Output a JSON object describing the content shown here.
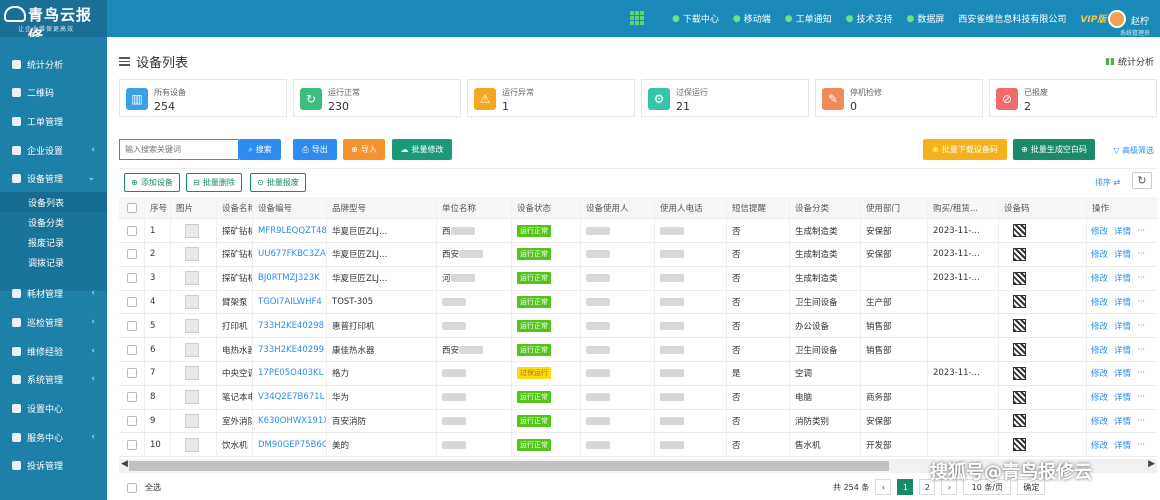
{
  "brand": {
    "title": "青鸟云报修",
    "slogan": "让企业维保更高效"
  },
  "topnav": [
    {
      "icon": "download-icon",
      "label": "下载中心"
    },
    {
      "icon": "mobile-icon",
      "label": "移动端"
    },
    {
      "icon": "bell-icon",
      "label": "工单通知"
    },
    {
      "icon": "support-icon",
      "label": "技术支持"
    },
    {
      "icon": "chart-icon",
      "label": "数据屏"
    }
  ],
  "company": "西安雀维信息科技有限公司",
  "vip": "VIP版",
  "user": {
    "name": "赵柠",
    "role": "系统管理员"
  },
  "sidebar": [
    {
      "label": "统计分析",
      "arrow": ""
    },
    {
      "label": "二维码",
      "arrow": ""
    },
    {
      "label": "工单管理",
      "arrow": ""
    },
    {
      "label": "企业设置",
      "arrow": "‹"
    },
    {
      "label": "设备管理",
      "arrow": "⌄"
    },
    {
      "label": "耗材管理",
      "arrow": "‹"
    },
    {
      "label": "巡检管理",
      "arrow": "‹"
    },
    {
      "label": "维修经验",
      "arrow": "‹"
    },
    {
      "label": "系统管理",
      "arrow": "‹"
    },
    {
      "label": "设置中心",
      "arrow": ""
    },
    {
      "label": "服务中心",
      "arrow": "‹"
    },
    {
      "label": "投诉管理",
      "arrow": ""
    }
  ],
  "submenu": [
    "设备列表",
    "设备分类",
    "报废记录",
    "调拨记录"
  ],
  "page_title": "设备列表",
  "stat_link": "统计分析",
  "cards": [
    {
      "label": "所有设备",
      "value": "254",
      "color": "#3aa0e8",
      "glyph": "▥"
    },
    {
      "label": "运行正常",
      "value": "230",
      "color": "#3dbd7d",
      "glyph": "↻"
    },
    {
      "label": "运行异常",
      "value": "1",
      "color": "#f5a623",
      "glyph": "⚠"
    },
    {
      "label": "过保运行",
      "value": "21",
      "color": "#36c3a8",
      "glyph": "⚙"
    },
    {
      "label": "停机检修",
      "value": "0",
      "color": "#f08a5d",
      "glyph": "✎"
    },
    {
      "label": "已报废",
      "value": "2",
      "color": "#f06b6b",
      "glyph": "⊘"
    }
  ],
  "search": {
    "placeholder": "输入搜索关键词",
    "button": "搜索"
  },
  "buttons": {
    "export": "导出",
    "import": "导入",
    "batch_edit": "批量修改",
    "batch_download": "批量下载设备码",
    "batch_blank": "批量生成空白码",
    "filter": "高级筛选",
    "add": "添加设备",
    "batch_delete": "批量删除",
    "batch_scrap": "批量报废",
    "sort": "排序 ⇄"
  },
  "columns": [
    "序号",
    "图片",
    "设备名称",
    "设备编号",
    "品牌型号",
    "单位名称",
    "设备状态",
    "设备使用人",
    "使用人电话",
    "短信提醒",
    "设备分类",
    "使用部门",
    "购买/租赁...",
    "设备码",
    "操作"
  ],
  "rows": [
    {
      "no": "1",
      "name": "探矿钻机",
      "code": "MFR9LEQQZT48",
      "brand": "华夏巨匠ZLJ...",
      "unit": "西",
      "status": "运行正常",
      "sms": "否",
      "cat": "生成制造类",
      "dept": "安保部",
      "date": "2023-11-..."
    },
    {
      "no": "2",
      "name": "探矿钻机",
      "code": "UU677FKBC3ZA",
      "brand": "华夏巨匠ZLJ...",
      "unit": "西安",
      "status": "运行正常",
      "sms": "否",
      "cat": "生成制造类",
      "dept": "安保部",
      "date": "2023-11-..."
    },
    {
      "no": "3",
      "name": "探矿钻机",
      "code": "BJ0RTMZJ323K",
      "brand": "华夏巨匠ZLJ...",
      "unit": "河",
      "status": "运行正常",
      "sms": "否",
      "cat": "生成制造类",
      "dept": "",
      "date": "2023-11-..."
    },
    {
      "no": "4",
      "name": "臂架泵",
      "code": "TGOI7AILWHF4",
      "brand": "TOST-305",
      "unit": "",
      "status": "运行正常",
      "sms": "否",
      "cat": "卫生间设备",
      "dept": "生产部",
      "date": ""
    },
    {
      "no": "5",
      "name": "打印机",
      "code": "733H2KE40298",
      "brand": "惠普打印机",
      "unit": "",
      "status": "运行正常",
      "sms": "否",
      "cat": "办公设备",
      "dept": "销售部",
      "date": ""
    },
    {
      "no": "6",
      "name": "电热水器",
      "code": "733H2KE40299",
      "brand": "康佳热水器",
      "unit": "西安",
      "status": "运行正常",
      "sms": "否",
      "cat": "卫生间设备",
      "dept": "销售部",
      "date": ""
    },
    {
      "no": "7",
      "name": "中央空调",
      "code": "17PE05O403KL",
      "brand": "格力",
      "unit": "",
      "status": "过保运行",
      "sms": "是",
      "cat": "空调",
      "dept": "",
      "date": "2023-11-..."
    },
    {
      "no": "8",
      "name": "笔记本电脑",
      "code": "V34Q2E7B671L",
      "brand": "华为",
      "unit": "",
      "status": "运行正常",
      "sms": "否",
      "cat": "电脑",
      "dept": "商务部",
      "date": ""
    },
    {
      "no": "9",
      "name": "室外消防栓",
      "code": "K630OHWX191X",
      "brand": "百安消防",
      "unit": "",
      "status": "运行正常",
      "sms": "否",
      "cat": "消防类别",
      "dept": "安保部",
      "date": ""
    },
    {
      "no": "10",
      "name": "饮水机",
      "code": "DM90GEP75B6C",
      "brand": "美的",
      "unit": "",
      "status": "运行正常",
      "sms": "否",
      "cat": "售水机",
      "dept": "开发部",
      "date": ""
    }
  ],
  "row_actions": {
    "edit": "修改",
    "detail": "详情",
    "more": "···"
  },
  "status_colors": {
    "运行正常": "#52c41a",
    "过保运行": "#fadb14"
  },
  "footer": {
    "select_all": "全选",
    "total": "共 254 条",
    "pages": [
      "1",
      "2"
    ],
    "page_size": "10 条/页",
    "goto": "确定"
  },
  "watermark": "搜狐号@青鸟报修云"
}
